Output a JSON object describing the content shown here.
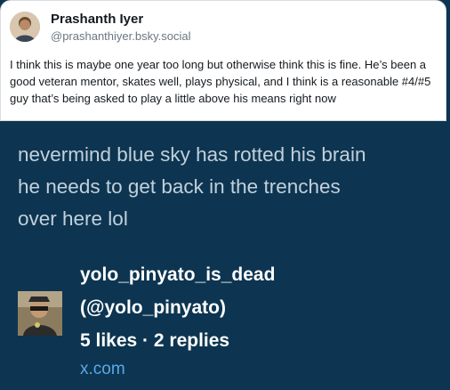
{
  "quoted_post": {
    "author_name": "Prashanth Iyer",
    "author_handle": "@prashanthiyer.bsky.social",
    "body": "I think this is maybe one year too long but otherwise think this is fine. He’s been a good veteran mentor, skates well, plays physical, and I think is a reasonable #4/#5 guy that’s being asked to play a little above his means right now"
  },
  "main_post": {
    "line1": "nevermind blue sky has rotted his brain",
    "line2": "he needs to get back in the trenches",
    "line3": "over here lol"
  },
  "author": {
    "display_name": "yolo_pinyato_is_dead",
    "handle": "(@yolo_pinyato)",
    "stats": "5 likes · 2 replies",
    "source_link": "x.com"
  },
  "colors": {
    "background": "#0d3551",
    "link": "#5ba8e6"
  }
}
